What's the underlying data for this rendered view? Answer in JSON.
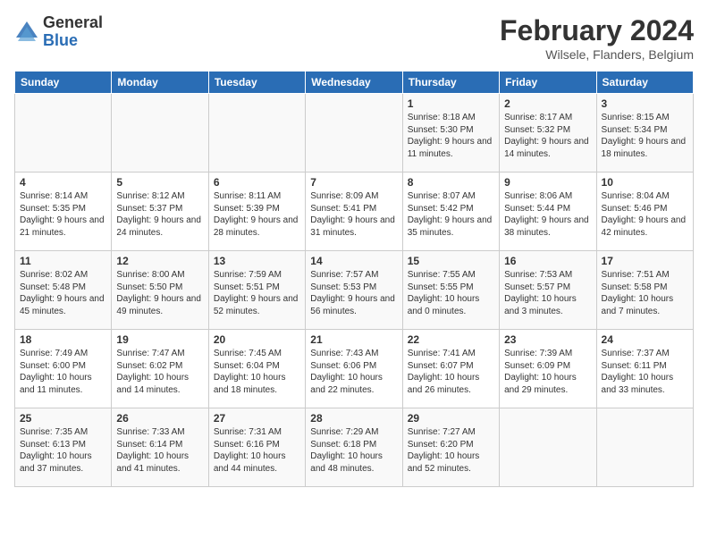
{
  "header": {
    "logo_line1": "General",
    "logo_line2": "Blue",
    "month_year": "February 2024",
    "location": "Wilsele, Flanders, Belgium"
  },
  "days_of_week": [
    "Sunday",
    "Monday",
    "Tuesday",
    "Wednesday",
    "Thursday",
    "Friday",
    "Saturday"
  ],
  "weeks": [
    [
      {
        "day": "",
        "info": ""
      },
      {
        "day": "",
        "info": ""
      },
      {
        "day": "",
        "info": ""
      },
      {
        "day": "",
        "info": ""
      },
      {
        "day": "1",
        "info": "Sunrise: 8:18 AM\nSunset: 5:30 PM\nDaylight: 9 hours and 11 minutes."
      },
      {
        "day": "2",
        "info": "Sunrise: 8:17 AM\nSunset: 5:32 PM\nDaylight: 9 hours and 14 minutes."
      },
      {
        "day": "3",
        "info": "Sunrise: 8:15 AM\nSunset: 5:34 PM\nDaylight: 9 hours and 18 minutes."
      }
    ],
    [
      {
        "day": "4",
        "info": "Sunrise: 8:14 AM\nSunset: 5:35 PM\nDaylight: 9 hours and 21 minutes."
      },
      {
        "day": "5",
        "info": "Sunrise: 8:12 AM\nSunset: 5:37 PM\nDaylight: 9 hours and 24 minutes."
      },
      {
        "day": "6",
        "info": "Sunrise: 8:11 AM\nSunset: 5:39 PM\nDaylight: 9 hours and 28 minutes."
      },
      {
        "day": "7",
        "info": "Sunrise: 8:09 AM\nSunset: 5:41 PM\nDaylight: 9 hours and 31 minutes."
      },
      {
        "day": "8",
        "info": "Sunrise: 8:07 AM\nSunset: 5:42 PM\nDaylight: 9 hours and 35 minutes."
      },
      {
        "day": "9",
        "info": "Sunrise: 8:06 AM\nSunset: 5:44 PM\nDaylight: 9 hours and 38 minutes."
      },
      {
        "day": "10",
        "info": "Sunrise: 8:04 AM\nSunset: 5:46 PM\nDaylight: 9 hours and 42 minutes."
      }
    ],
    [
      {
        "day": "11",
        "info": "Sunrise: 8:02 AM\nSunset: 5:48 PM\nDaylight: 9 hours and 45 minutes."
      },
      {
        "day": "12",
        "info": "Sunrise: 8:00 AM\nSunset: 5:50 PM\nDaylight: 9 hours and 49 minutes."
      },
      {
        "day": "13",
        "info": "Sunrise: 7:59 AM\nSunset: 5:51 PM\nDaylight: 9 hours and 52 minutes."
      },
      {
        "day": "14",
        "info": "Sunrise: 7:57 AM\nSunset: 5:53 PM\nDaylight: 9 hours and 56 minutes."
      },
      {
        "day": "15",
        "info": "Sunrise: 7:55 AM\nSunset: 5:55 PM\nDaylight: 10 hours and 0 minutes."
      },
      {
        "day": "16",
        "info": "Sunrise: 7:53 AM\nSunset: 5:57 PM\nDaylight: 10 hours and 3 minutes."
      },
      {
        "day": "17",
        "info": "Sunrise: 7:51 AM\nSunset: 5:58 PM\nDaylight: 10 hours and 7 minutes."
      }
    ],
    [
      {
        "day": "18",
        "info": "Sunrise: 7:49 AM\nSunset: 6:00 PM\nDaylight: 10 hours and 11 minutes."
      },
      {
        "day": "19",
        "info": "Sunrise: 7:47 AM\nSunset: 6:02 PM\nDaylight: 10 hours and 14 minutes."
      },
      {
        "day": "20",
        "info": "Sunrise: 7:45 AM\nSunset: 6:04 PM\nDaylight: 10 hours and 18 minutes."
      },
      {
        "day": "21",
        "info": "Sunrise: 7:43 AM\nSunset: 6:06 PM\nDaylight: 10 hours and 22 minutes."
      },
      {
        "day": "22",
        "info": "Sunrise: 7:41 AM\nSunset: 6:07 PM\nDaylight: 10 hours and 26 minutes."
      },
      {
        "day": "23",
        "info": "Sunrise: 7:39 AM\nSunset: 6:09 PM\nDaylight: 10 hours and 29 minutes."
      },
      {
        "day": "24",
        "info": "Sunrise: 7:37 AM\nSunset: 6:11 PM\nDaylight: 10 hours and 33 minutes."
      }
    ],
    [
      {
        "day": "25",
        "info": "Sunrise: 7:35 AM\nSunset: 6:13 PM\nDaylight: 10 hours and 37 minutes."
      },
      {
        "day": "26",
        "info": "Sunrise: 7:33 AM\nSunset: 6:14 PM\nDaylight: 10 hours and 41 minutes."
      },
      {
        "day": "27",
        "info": "Sunrise: 7:31 AM\nSunset: 6:16 PM\nDaylight: 10 hours and 44 minutes."
      },
      {
        "day": "28",
        "info": "Sunrise: 7:29 AM\nSunset: 6:18 PM\nDaylight: 10 hours and 48 minutes."
      },
      {
        "day": "29",
        "info": "Sunrise: 7:27 AM\nSunset: 6:20 PM\nDaylight: 10 hours and 52 minutes."
      },
      {
        "day": "",
        "info": ""
      },
      {
        "day": "",
        "info": ""
      }
    ]
  ]
}
